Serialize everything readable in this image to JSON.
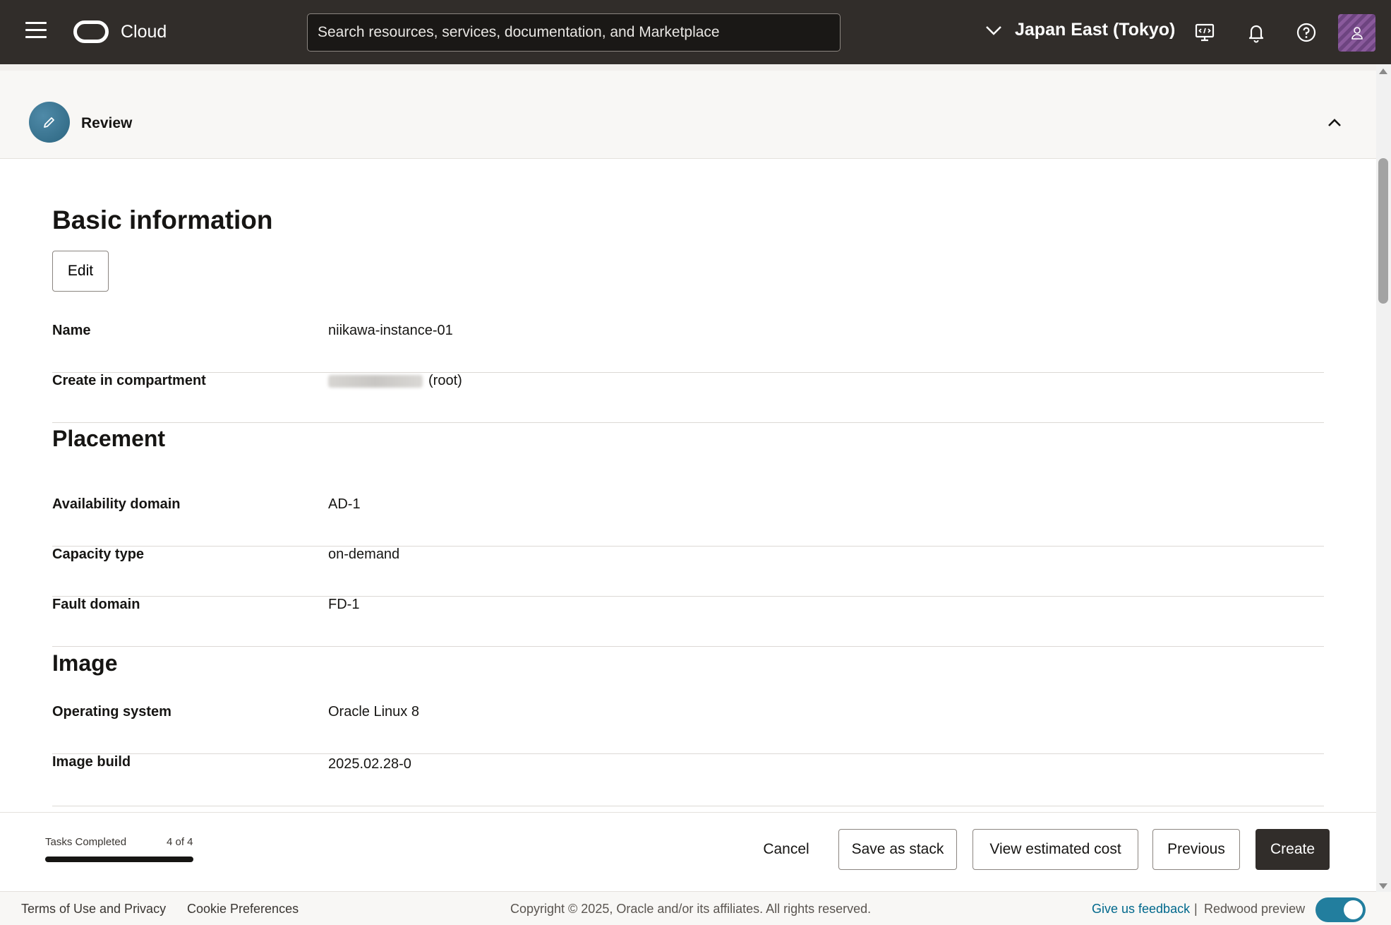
{
  "header": {
    "brand": "Cloud",
    "search_placeholder": "Search resources, services, documentation, and Marketplace",
    "region": "Japan East (Tokyo)"
  },
  "review": {
    "title": "Review"
  },
  "basic_information": {
    "heading": "Basic information",
    "edit_label": "Edit",
    "rows": [
      {
        "label": "Name",
        "value": "niikawa-instance-01"
      },
      {
        "label": "Create in compartment",
        "value": "(root)"
      }
    ]
  },
  "placement": {
    "heading": "Placement",
    "rows": [
      {
        "label": "Availability domain",
        "value": "AD-1"
      },
      {
        "label": "Capacity type",
        "value": "on-demand"
      },
      {
        "label": "Fault domain",
        "value": "FD-1"
      }
    ]
  },
  "image": {
    "heading": "Image",
    "rows": [
      {
        "label": "Operating system",
        "value": "Oracle Linux 8"
      },
      {
        "label": "Image build",
        "value": "2025.02.28-0"
      }
    ]
  },
  "action_bar": {
    "tasks_label": "Tasks Completed",
    "tasks_count": "4 of 4",
    "progress_fraction": 1.0,
    "cancel": "Cancel",
    "save_as_stack": "Save as stack",
    "view_cost": "View estimated cost",
    "previous": "Previous",
    "create": "Create"
  },
  "footer": {
    "terms": "Terms of Use and Privacy",
    "cookies": "Cookie Preferences",
    "copyright": "Copyright © 2025, Oracle and/or its affiliates. All rights reserved.",
    "feedback": "Give us feedback",
    "separator": "|",
    "redwood": "Redwood preview",
    "redwood_enabled": true
  },
  "colors": {
    "header_bg": "#312d2a",
    "accent_link": "#00688c",
    "toggle_on": "#227e9e",
    "primary_button": "#312d2a"
  }
}
